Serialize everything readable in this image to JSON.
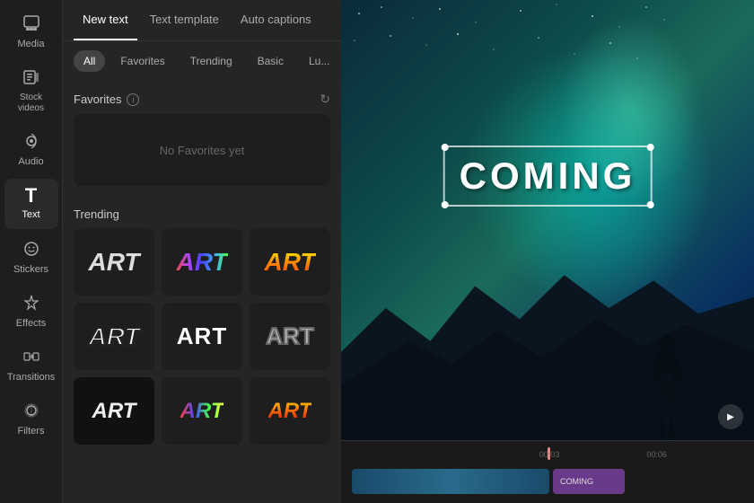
{
  "sidebar": {
    "items": [
      {
        "id": "media",
        "label": "Media",
        "icon": "⊞"
      },
      {
        "id": "stock-videos",
        "label": "Stock\nvideos",
        "icon": "▦"
      },
      {
        "id": "audio",
        "label": "Audio",
        "icon": "♫"
      },
      {
        "id": "text",
        "label": "Text",
        "icon": "T",
        "active": true
      },
      {
        "id": "stickers",
        "label": "Stickers",
        "icon": "☺"
      },
      {
        "id": "effects",
        "label": "Effects",
        "icon": "✦"
      },
      {
        "id": "transitions",
        "label": "Transitions",
        "icon": "↔"
      },
      {
        "id": "filters",
        "label": "Filters",
        "icon": "◉"
      }
    ]
  },
  "tabs": [
    {
      "id": "new-text",
      "label": "New text",
      "active": true
    },
    {
      "id": "text-template",
      "label": "Text template"
    },
    {
      "id": "auto-captions",
      "label": "Auto captions"
    }
  ],
  "filters": [
    {
      "id": "all",
      "label": "All",
      "active": true
    },
    {
      "id": "favorites",
      "label": "Favorites"
    },
    {
      "id": "trending",
      "label": "Trending"
    },
    {
      "id": "basic",
      "label": "Basic"
    },
    {
      "id": "lu",
      "label": "Lu..."
    }
  ],
  "sections": {
    "favorites": {
      "title": "Favorites",
      "empty_message": "No Favorites yet"
    },
    "trending": {
      "title": "Trending"
    }
  },
  "preview": {
    "text": "COMING",
    "play_label": "▶"
  },
  "timeline": {
    "markers": [
      "00:03",
      "00:06"
    ]
  },
  "style_cards": [
    {
      "id": "s1",
      "style": "plain"
    },
    {
      "id": "s2",
      "style": "rainbow"
    },
    {
      "id": "s3",
      "style": "fire"
    },
    {
      "id": "s4",
      "style": "outline-bold"
    },
    {
      "id": "s5",
      "style": "white-outline"
    },
    {
      "id": "s6",
      "style": "dark-stroke"
    },
    {
      "id": "s7",
      "style": "plain2"
    },
    {
      "id": "s8",
      "style": "rainbow2"
    },
    {
      "id": "s9",
      "style": "fire2"
    }
  ]
}
